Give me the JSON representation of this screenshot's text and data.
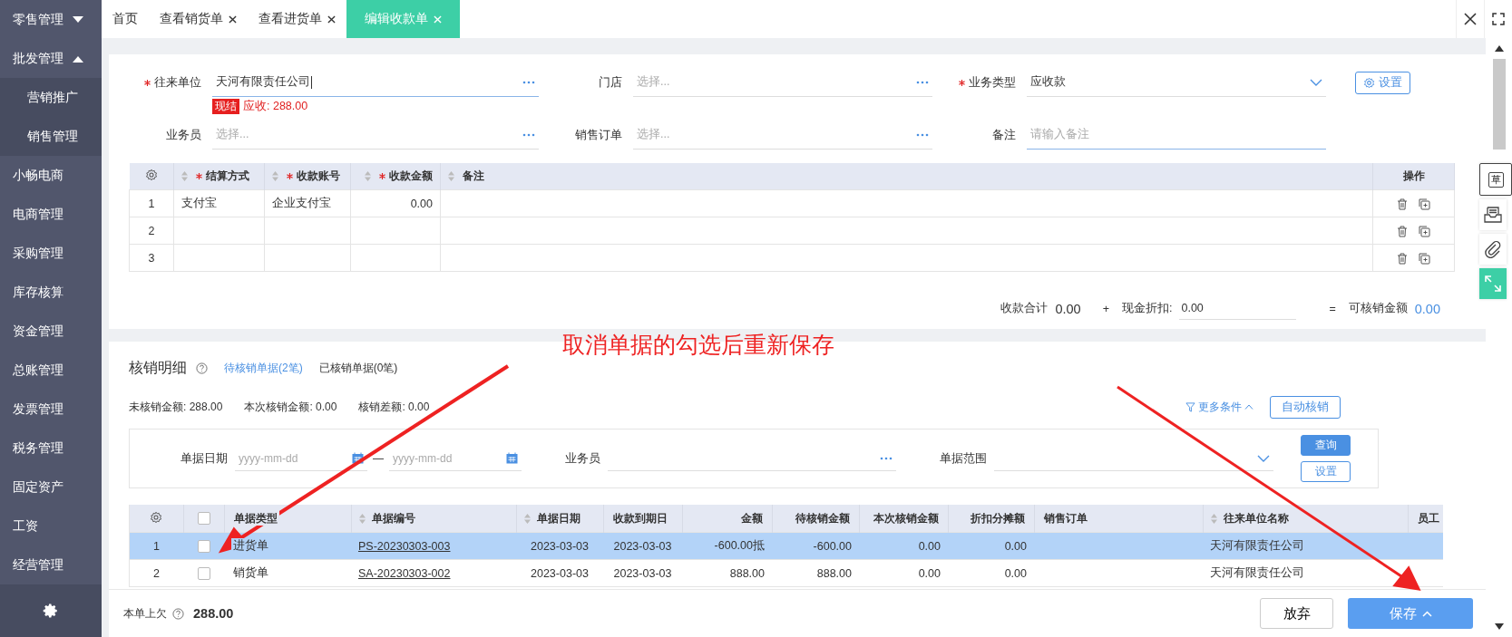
{
  "sidebar": {
    "items": [
      {
        "label": "零售管理",
        "kind": "group",
        "expanded": false
      },
      {
        "label": "批发管理",
        "kind": "group",
        "expanded": true
      },
      {
        "label": "营销推广",
        "kind": "sub"
      },
      {
        "label": "销售管理",
        "kind": "sub"
      },
      {
        "label": "小畅电商",
        "kind": "item"
      },
      {
        "label": "电商管理",
        "kind": "item"
      },
      {
        "label": "采购管理",
        "kind": "item"
      },
      {
        "label": "库存核算",
        "kind": "item"
      },
      {
        "label": "资金管理",
        "kind": "item"
      },
      {
        "label": "总账管理",
        "kind": "item"
      },
      {
        "label": "发票管理",
        "kind": "item"
      },
      {
        "label": "税务管理",
        "kind": "item"
      },
      {
        "label": "固定资产",
        "kind": "item"
      },
      {
        "label": "工资",
        "kind": "item"
      },
      {
        "label": "经营管理",
        "kind": "item"
      }
    ]
  },
  "tabs": [
    {
      "label": "首页",
      "closable": false,
      "selected": false
    },
    {
      "label": "查看销货单",
      "closable": true,
      "selected": false
    },
    {
      "label": "查看进货单",
      "closable": true,
      "selected": false
    },
    {
      "label": "编辑收款单",
      "closable": true,
      "selected": true
    }
  ],
  "form": {
    "fields": [
      {
        "label": "往来单位",
        "required": true,
        "kind": "lookup",
        "value": "天河有限责任公司"
      },
      {
        "label": "门店",
        "required": false,
        "kind": "lookup",
        "placeholder": "选择..."
      },
      {
        "label": "业务类型",
        "required": true,
        "kind": "select",
        "value": "应收款"
      },
      {
        "label": "业务员",
        "required": false,
        "kind": "lookup",
        "placeholder": "选择..."
      },
      {
        "label": "销售订单",
        "required": false,
        "kind": "lookup",
        "placeholder": "选择..."
      },
      {
        "label": "备注",
        "required": false,
        "kind": "text",
        "placeholder": "请输入备注"
      }
    ],
    "settings_button": "设置",
    "balance": {
      "badge": "现结",
      "text": "应收: 288.00"
    }
  },
  "payments": {
    "columns": [
      {
        "label": "结算方式",
        "required": true
      },
      {
        "label": "收款账号",
        "required": true
      },
      {
        "label": "收款金额",
        "required": true
      },
      {
        "label": "备注",
        "required": false
      },
      {
        "label": "操作",
        "required": false
      }
    ],
    "rows": [
      {
        "no": "1",
        "method": "支付宝",
        "account": "企业支付宝",
        "amount": "0.00"
      },
      {
        "no": "2"
      },
      {
        "no": "3"
      }
    ]
  },
  "totals": {
    "sum_label": "收款合计",
    "sum": "0.00",
    "plus": "+",
    "discount_label": "现金折扣:",
    "discount": "0.00",
    "equals": "=",
    "available_label": "可核销金额",
    "available": "0.00"
  },
  "writeoff": {
    "title": "核销明细",
    "tabs": [
      {
        "label": "待核销单据(2笔)",
        "selected": true
      },
      {
        "label": "已核销单据(0笔)",
        "selected": false
      }
    ],
    "summary": [
      "未核销金额: 288.00",
      "本次核销金额: 0.00",
      "核销差额: 0.00"
    ],
    "more_conditions": "更多条件",
    "select_all_checked": false,
    "auto_button": "自动核销",
    "filters": {
      "date_label": "单据日期",
      "date_from": "yyyy-mm-dd",
      "dash": "—",
      "date_to": "yyyy-mm-dd",
      "staff_label": "业务员",
      "range_label": "单据范围",
      "query_button": "查询",
      "settings_button": "设置"
    },
    "columns": [
      {
        "label": "单据类型",
        "sortable": false
      },
      {
        "label": "单据编号",
        "sortable": true
      },
      {
        "label": "单据日期",
        "sortable": true
      },
      {
        "label": "收款到期日",
        "sortable": false
      },
      {
        "label": "金额",
        "sortable": false
      },
      {
        "label": "待核销金额",
        "sortable": false
      },
      {
        "label": "本次核销金额",
        "sortable": false
      },
      {
        "label": "折扣分摊额",
        "sortable": false
      },
      {
        "label": "销售订单",
        "sortable": false
      },
      {
        "label": "往来单位名称",
        "sortable": true
      },
      {
        "label": "员工",
        "sortable": false
      }
    ],
    "rows": [
      {
        "no": "1",
        "checked": false,
        "selected": true,
        "type": "进货单",
        "code": "PS-20230303-003",
        "date": "2023-03-03",
        "due": "2023-03-03",
        "amount": "-600.00",
        "amount_tag": "抵",
        "pending": "-600.00",
        "current": "0.00",
        "discount": "0.00",
        "partner": "天河有限责任公司"
      },
      {
        "no": "2",
        "checked": false,
        "selected": false,
        "type": "销货单",
        "code": "SA-20230303-002",
        "date": "2023-03-03",
        "due": "2023-03-03",
        "amount": "888.00",
        "pending": "888.00",
        "current": "0.00",
        "discount": "0.00",
        "partner": "天河有限责任公司"
      }
    ]
  },
  "footer": {
    "owed_label": "本单上欠",
    "owed": "288.00",
    "discard_button": "放弃",
    "save_button": "保存"
  },
  "side_tools": [
    {
      "kind": "draft",
      "label": "草"
    },
    {
      "kind": "inbox"
    },
    {
      "kind": "attach"
    },
    {
      "kind": "expand"
    }
  ],
  "annotation": {
    "text": "取消单据的勾选后重新保存"
  }
}
